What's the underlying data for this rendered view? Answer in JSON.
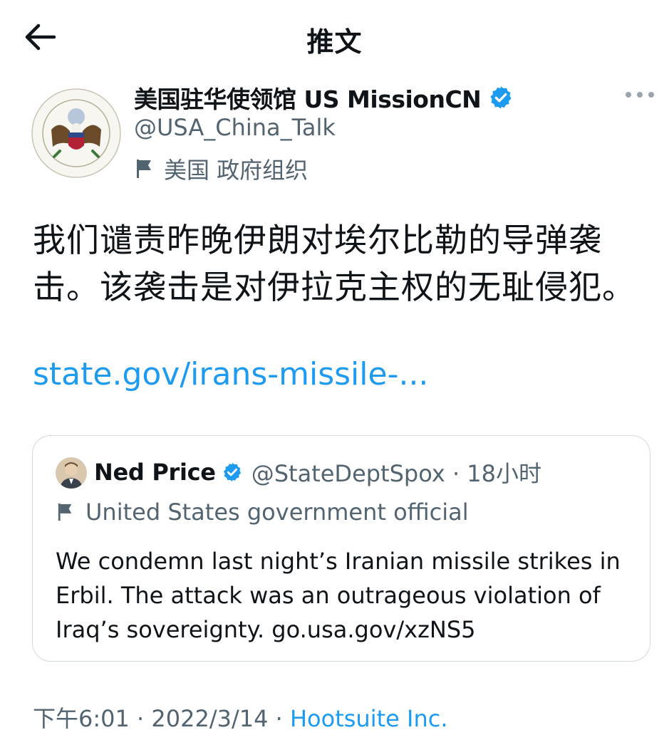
{
  "header": {
    "title": "推文"
  },
  "account": {
    "display_name": "美国驻华使领馆 US MissionCN",
    "handle": "@USA_China_Talk",
    "label": "美国 政府组织"
  },
  "tweet": {
    "text": "我们谴责昨晚伊朗对埃尔比勒的导弹袭击。该袭击是对伊拉克主权的无耻侵犯。",
    "link": "state.gov/irans-missile-..."
  },
  "quote": {
    "name": "Ned Price",
    "handle_time": "@StateDeptSpox · 18小时",
    "label": "United States government official",
    "text": "We condemn last night’s Iranian missile strikes in Erbil. The attack was an outrageous violation of Iraq’s sovereignty. go.usa.gov/xzNS5"
  },
  "meta": {
    "time_date": "下午6:01 · 2022/3/14 · ",
    "source": "Hootsuite Inc."
  },
  "colors": {
    "accent_blue": "#1d9bf0",
    "secondary_text": "#536471",
    "border": "#cfd9de"
  },
  "icons": [
    "back-arrow-icon",
    "verified-badge-icon",
    "flag-icon",
    "more-options-icon"
  ]
}
